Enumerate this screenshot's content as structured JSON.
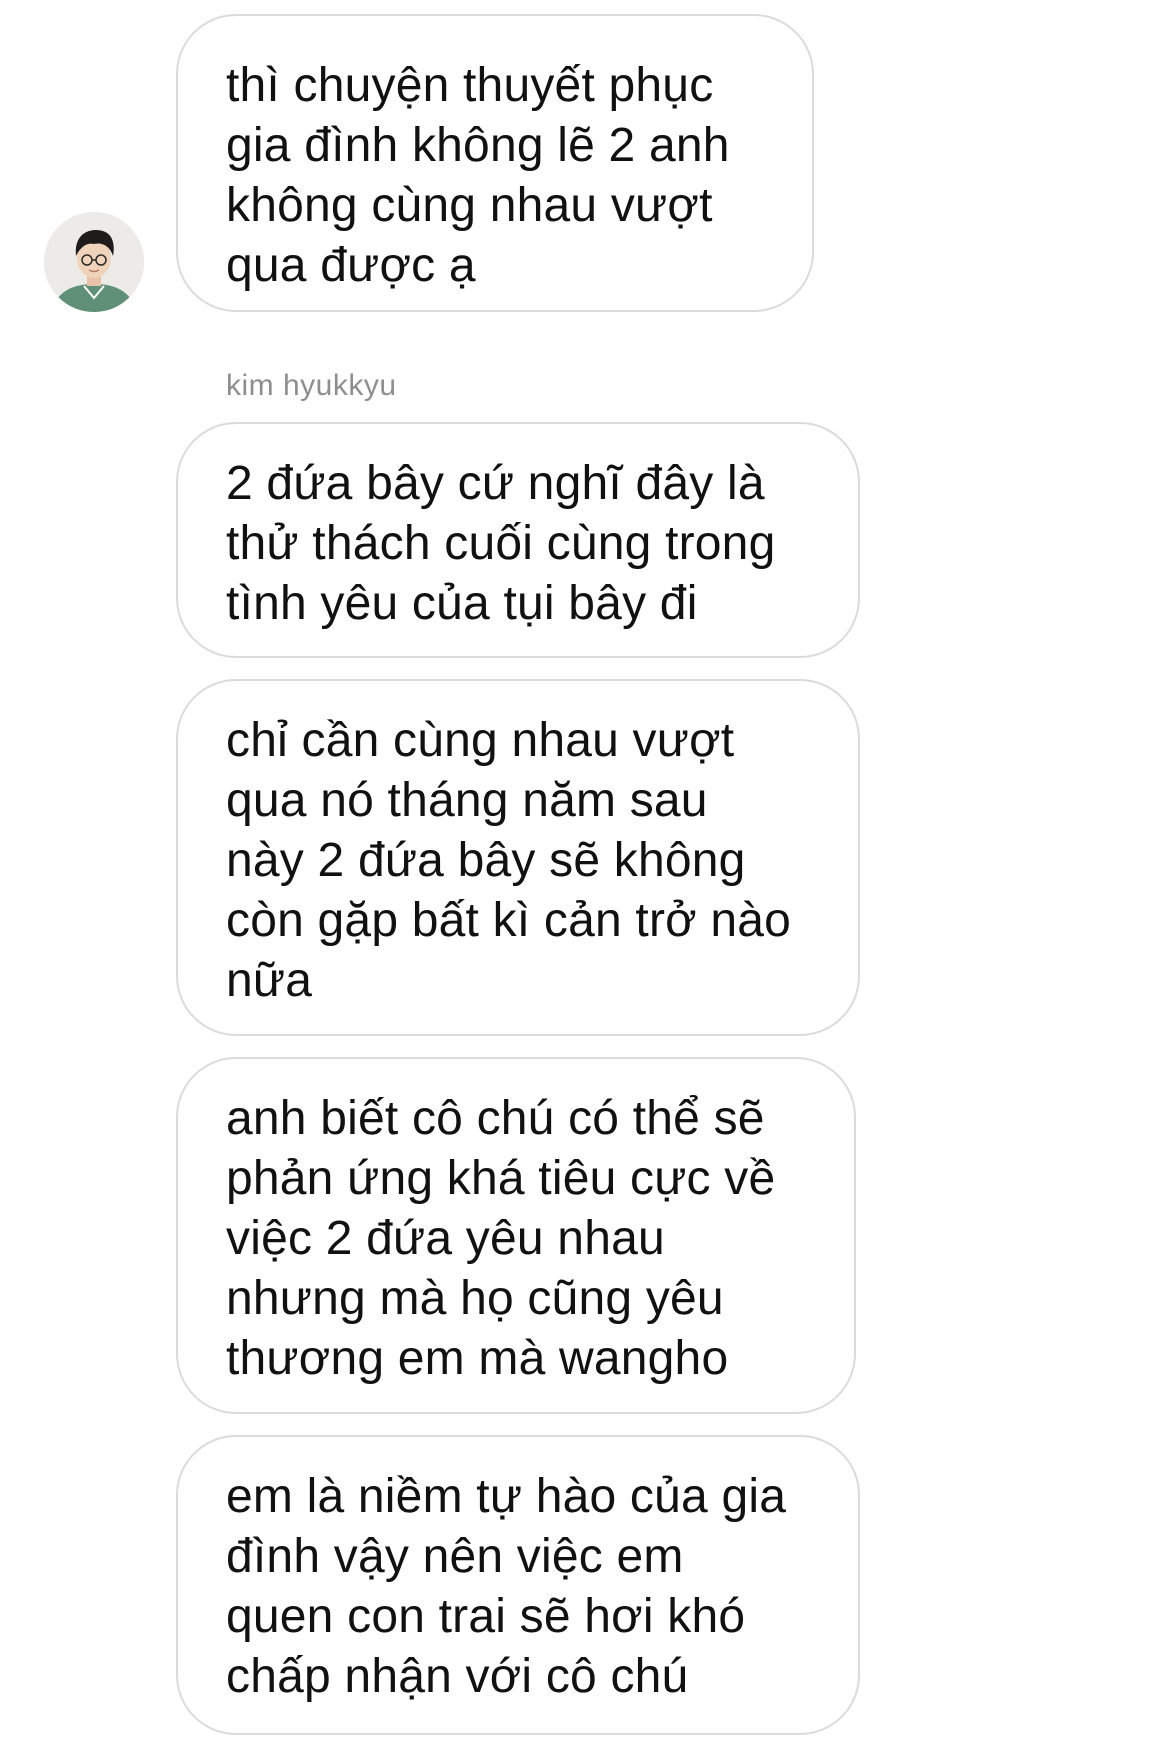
{
  "sender": {
    "name": "kim hyukkyu"
  },
  "messages": [
    {
      "lines": [
        "thì chuyện thuyết phục",
        "gia đình không lẽ 2 anh",
        "không cùng nhau vượt",
        "qua được ạ"
      ]
    },
    {
      "lines": [
        "2 đứa bây cứ nghĩ đây là",
        "thử thách cuối cùng trong",
        "tình yêu của tụi bây đi"
      ]
    },
    {
      "lines": [
        "chỉ cần cùng nhau vượt",
        "qua nó tháng năm sau",
        "này 2 đứa bây sẽ không",
        "còn gặp bất kì cản trở nào",
        "nữa"
      ]
    },
    {
      "lines": [
        "anh biết cô chú có thể sẽ",
        "phản ứng khá tiêu cực về",
        "việc 2 đứa yêu nhau",
        "nhưng mà họ cũng yêu",
        "thương em mà wangho"
      ]
    },
    {
      "lines": [
        "em là niềm tự hào của gia",
        "đình vậy nên việc em",
        "quen con trai sẽ hơi khó",
        "chấp nhận với cô chú"
      ]
    }
  ],
  "icons": {
    "avatar": "profile-photo"
  },
  "colors": {
    "background": "#ffffff",
    "bubble_border": "#dbdbdb",
    "text": "#111111",
    "sender_label": "#8e8e8e"
  }
}
